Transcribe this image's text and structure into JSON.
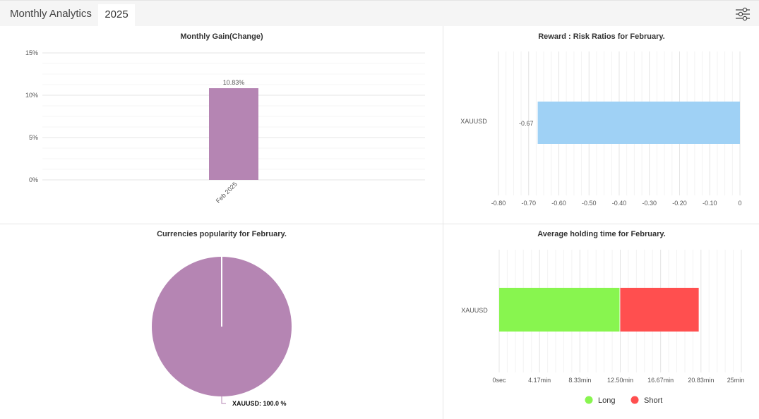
{
  "header": {
    "title": "Monthly Analytics",
    "year_tab": "2025",
    "filter_icon": "sliders-icon"
  },
  "colors": {
    "gain_bar": "#b585b3",
    "risk_bar": "#9fd1f5",
    "long": "#88f54f",
    "short": "#ff4f4f",
    "pie": "#b585b3"
  },
  "chart_data": [
    {
      "type": "bar",
      "title": "Monthly Gain(Change)",
      "categories": [
        "Feb 2025"
      ],
      "values": [
        10.83
      ],
      "data_labels": [
        "10.83%"
      ],
      "yticks": [
        "0%",
        "5%",
        "10%",
        "15%"
      ],
      "ylim": [
        0,
        15
      ],
      "grid": true,
      "xlabel": "",
      "ylabel": ""
    },
    {
      "type": "bar",
      "orientation": "horizontal",
      "title": "Reward : Risk Ratios for February.",
      "categories": [
        "XAUUSD"
      ],
      "values": [
        -0.67
      ],
      "data_labels": [
        "-0.67"
      ],
      "xticks": [
        "-0.80",
        "-0.70",
        "-0.60",
        "-0.50",
        "-0.40",
        "-0.30",
        "-0.20",
        "-0.10",
        "0"
      ],
      "xlim": [
        -0.8,
        0
      ],
      "grid": true
    },
    {
      "type": "pie",
      "title": "Currencies popularity for February.",
      "slices": [
        {
          "label": "XAUUSD",
          "value": 100.0
        }
      ],
      "data_labels": [
        "XAUUSD: 100.0 %"
      ]
    },
    {
      "type": "bar",
      "orientation": "horizontal",
      "stacked": true,
      "title": "Average holding time for February.",
      "categories": [
        "XAUUSD"
      ],
      "series": [
        {
          "name": "Long",
          "values": [
            12.5
          ],
          "unit": "min"
        },
        {
          "name": "Short",
          "values": [
            8.1
          ],
          "unit": "min"
        }
      ],
      "xticks": [
        "0sec",
        "4.17min",
        "8.33min",
        "12.50min",
        "16.67min",
        "20.83min",
        "25min"
      ],
      "xlim": [
        0,
        25
      ],
      "legend": [
        "Long",
        "Short"
      ],
      "legend_position": "bottom",
      "grid": true
    }
  ]
}
